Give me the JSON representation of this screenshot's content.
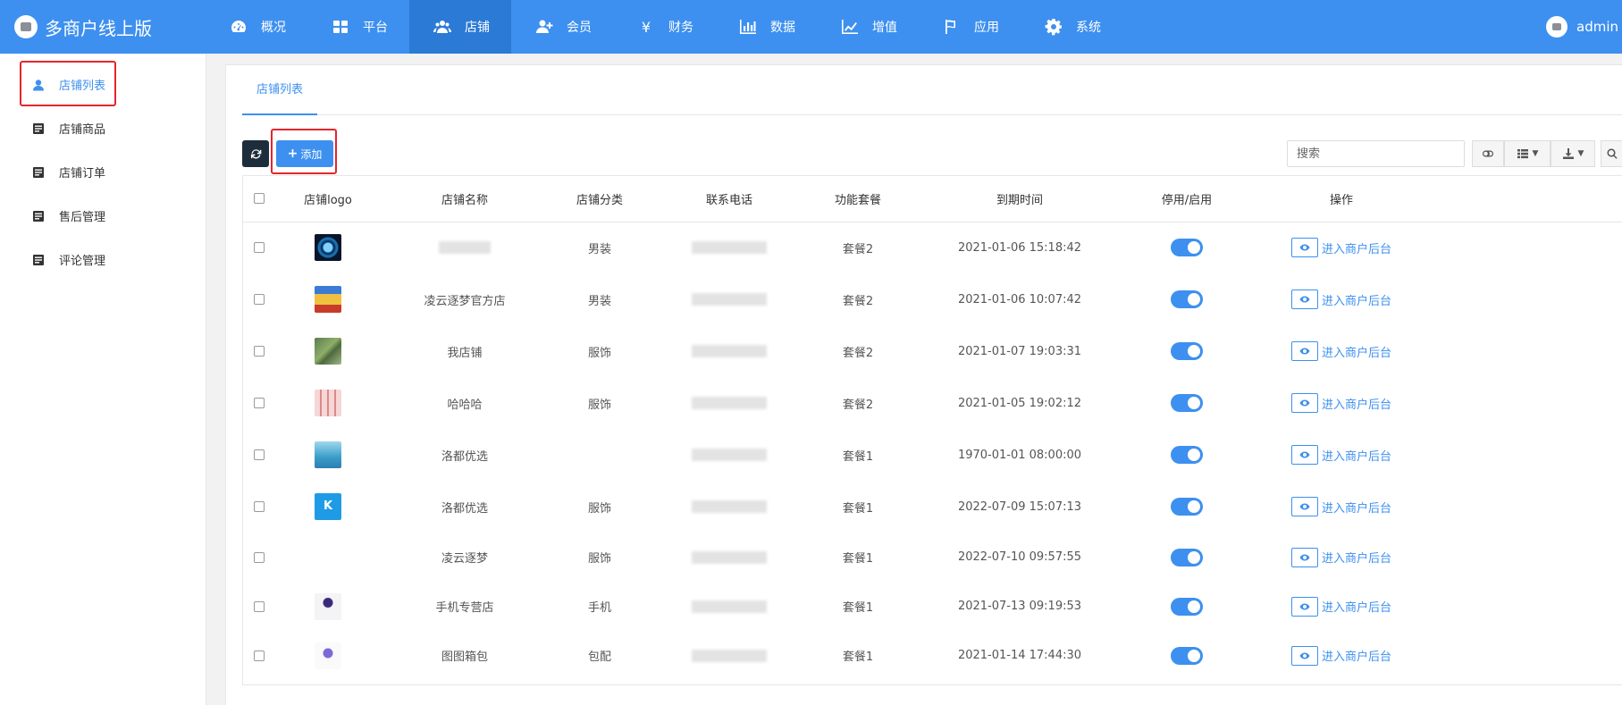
{
  "app": {
    "title": "多商户线上版"
  },
  "nav": {
    "items": [
      {
        "label": "概况",
        "icon": "dashboard-icon"
      },
      {
        "label": "平台",
        "icon": "grid-icon"
      },
      {
        "label": "店铺",
        "icon": "users-icon",
        "active": true
      },
      {
        "label": "会员",
        "icon": "user-plus-icon"
      },
      {
        "label": "财务",
        "icon": "yen-icon"
      },
      {
        "label": "数据",
        "icon": "bar-chart-icon"
      },
      {
        "label": "增值",
        "icon": "line-chart-icon"
      },
      {
        "label": "应用",
        "icon": "flag-icon"
      },
      {
        "label": "系统",
        "icon": "gear-icon"
      }
    ]
  },
  "user": {
    "name": "admin"
  },
  "sidebar": {
    "items": [
      {
        "label": "店铺列表",
        "icon": "user-icon",
        "active": true
      },
      {
        "label": "店铺商品",
        "icon": "list-icon"
      },
      {
        "label": "店铺订单",
        "icon": "list-icon"
      },
      {
        "label": "售后管理",
        "icon": "list-icon"
      },
      {
        "label": "评论管理",
        "icon": "list-icon"
      }
    ]
  },
  "tabs": [
    {
      "label": "店铺列表"
    }
  ],
  "toolbar": {
    "refresh_icon": "refresh-icon",
    "add_label": "添加",
    "search_placeholder": "搜索"
  },
  "table": {
    "headers": [
      "店铺logo",
      "店铺名称",
      "店铺分类",
      "联系电话",
      "功能套餐",
      "到期时间",
      "停用/启用",
      "操作"
    ],
    "action_label": "进入商户后台",
    "rows": [
      {
        "name": "",
        "category": "男装",
        "package": "套餐2",
        "expire": "2021-01-06 15:18:42",
        "enabled": true
      },
      {
        "name": "凌云逐梦官方店",
        "category": "男装",
        "package": "套餐2",
        "expire": "2021-01-06 10:07:42",
        "enabled": true
      },
      {
        "name": "我店铺",
        "category": "服饰",
        "package": "套餐2",
        "expire": "2021-01-07 19:03:31",
        "enabled": true
      },
      {
        "name": "哈哈哈",
        "category": "服饰",
        "package": "套餐2",
        "expire": "2021-01-05 19:02:12",
        "enabled": true
      },
      {
        "name": "洛都优选",
        "category": "",
        "package": "套餐1",
        "expire": "1970-01-01 08:00:00",
        "enabled": true
      },
      {
        "name": "洛都优选",
        "category": "服饰",
        "package": "套餐1",
        "expire": "2022-07-09 15:07:13",
        "enabled": true
      },
      {
        "name": "凌云逐梦",
        "category": "服饰",
        "package": "套餐1",
        "expire": "2022-07-10 09:57:55",
        "enabled": true
      },
      {
        "name": "手机专营店",
        "category": "手机",
        "package": "套餐1",
        "expire": "2021-07-13 09:19:53",
        "enabled": true
      },
      {
        "name": "图图箱包",
        "category": "包配",
        "package": "套餐1",
        "expire": "2021-01-14 17:44:30",
        "enabled": true
      }
    ]
  },
  "colors": {
    "primary": "#3d90ef",
    "highlight": "#e5252a",
    "dark_button": "#1e2d3b"
  }
}
